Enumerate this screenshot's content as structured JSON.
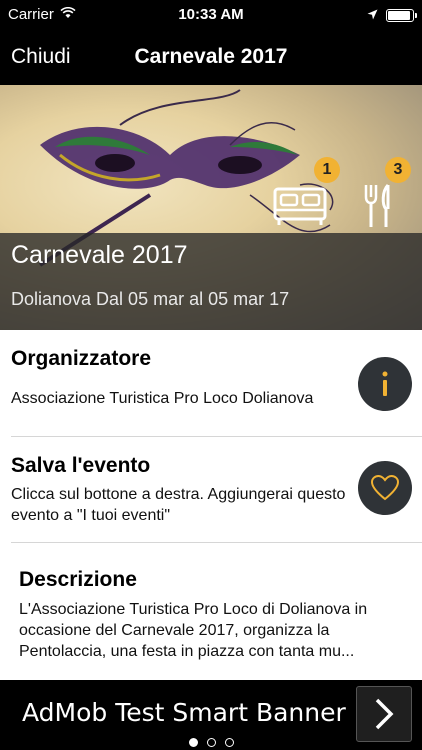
{
  "status_bar": {
    "carrier": "Carrier",
    "time": "10:33 AM"
  },
  "nav": {
    "close_label": "Chiudi",
    "title": "Carnevale 2017"
  },
  "hero": {
    "title": "Carnevale 2017",
    "subtitle": "Dolianova Dal 05 mar al 05 mar 17",
    "accommodation_count": "1",
    "restaurant_count": "3",
    "badge_color": "#f1b233"
  },
  "organizer": {
    "heading": "Organizzatore",
    "name": "Associazione Turistica Pro Loco Dolianova",
    "icon": "info-icon"
  },
  "save_event": {
    "heading": "Salva l'evento",
    "description": "Clicca sul bottone a destra. Aggiungerai questo evento a \"I tuoi eventi\"",
    "icon": "heart-icon"
  },
  "description": {
    "heading": "Descrizione",
    "text": "L'Associazione Turistica Pro Loco di Dolianova in occasione del Carnevale 2017, organizza la Pentolaccia, una festa in piazza con tanta mu..."
  },
  "ad_banner": {
    "label": "AdMob Test Smart Banner"
  },
  "pager": {
    "pages": 3,
    "current": 1
  }
}
